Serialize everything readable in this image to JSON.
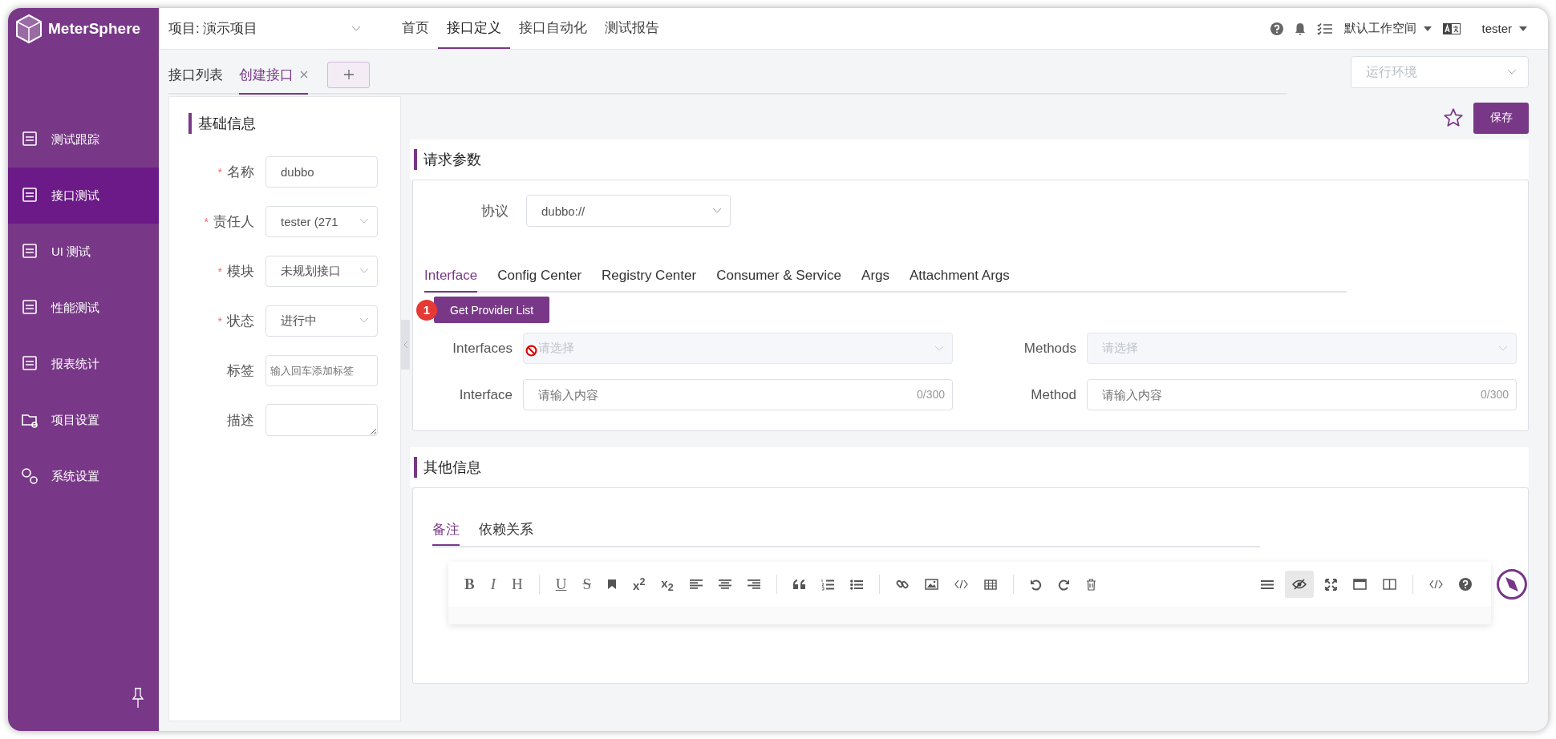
{
  "brand": {
    "name": "MeterSphere"
  },
  "sidebar": {
    "items": [
      {
        "label": "测试跟踪",
        "selected": false
      },
      {
        "label": "接口测试",
        "selected": true
      },
      {
        "label": "UI 测试",
        "selected": false
      },
      {
        "label": "性能测试",
        "selected": false
      },
      {
        "label": "报表统计",
        "selected": false
      },
      {
        "label": "项目设置",
        "selected": false
      },
      {
        "label": "系统设置",
        "selected": false
      }
    ]
  },
  "header": {
    "project": "项目: 演示项目",
    "nav": [
      {
        "label": "首页",
        "selected": false
      },
      {
        "label": "接口定义",
        "selected": true
      },
      {
        "label": "接口自动化",
        "selected": false
      },
      {
        "label": "测试报告",
        "selected": false
      }
    ],
    "workspace": "默认工作空间",
    "user": "tester"
  },
  "tabs": [
    {
      "label": "接口列表",
      "selected": false,
      "closable": false
    },
    {
      "label": "创建接口",
      "selected": true,
      "closable": true
    }
  ],
  "environment": {
    "placeholder": "运行环境"
  },
  "save_button": "保存",
  "basic_info": {
    "title": "基础信息",
    "required_mark": "*",
    "fields": [
      {
        "label": "名称",
        "required": true,
        "kind": "input",
        "value": "dubbo"
      },
      {
        "label": "责任人",
        "required": true,
        "kind": "select",
        "value": "tester (271"
      },
      {
        "label": "模块",
        "required": true,
        "kind": "select",
        "value": "未规划接口"
      },
      {
        "label": "状态",
        "required": true,
        "kind": "select",
        "value": "进行中"
      },
      {
        "label": "标签",
        "required": false,
        "kind": "input",
        "placeholder": "输入回车添加标签"
      },
      {
        "label": "描述",
        "required": false,
        "kind": "textarea"
      }
    ]
  },
  "request": {
    "title": "请求参数",
    "protocol_label": "协议",
    "protocol": "dubbo://",
    "tabs": [
      {
        "label": "Interface",
        "selected": true
      },
      {
        "label": "Config Center",
        "selected": false
      },
      {
        "label": "Registry Center",
        "selected": false
      },
      {
        "label": "Consumer & Service",
        "selected": false
      },
      {
        "label": "Args",
        "selected": false
      },
      {
        "label": "Attachment Args",
        "selected": false
      }
    ],
    "provider_button": "Get Provider List",
    "step_badge": "1",
    "fields": [
      {
        "label": "Interfaces",
        "kind": "select",
        "placeholder": "请选择",
        "disabled": true
      },
      {
        "label": "Methods",
        "kind": "select",
        "placeholder": "请选择",
        "disabled": true
      },
      {
        "label": "Interface",
        "kind": "input",
        "placeholder": "请输入内容",
        "counter": "0/300"
      },
      {
        "label": "Method",
        "kind": "input",
        "placeholder": "请输入内容",
        "counter": "0/300"
      }
    ]
  },
  "other": {
    "title": "其他信息",
    "tabs": [
      {
        "label": "备注",
        "selected": true
      },
      {
        "label": "依赖关系",
        "selected": false
      }
    ],
    "toolbar": {
      "format_labels": [
        "B",
        "I",
        "H",
        "U",
        "S",
        "x$^{2}$",
        "x$_{2}$"
      ],
      "preview_on": true
    }
  }
}
